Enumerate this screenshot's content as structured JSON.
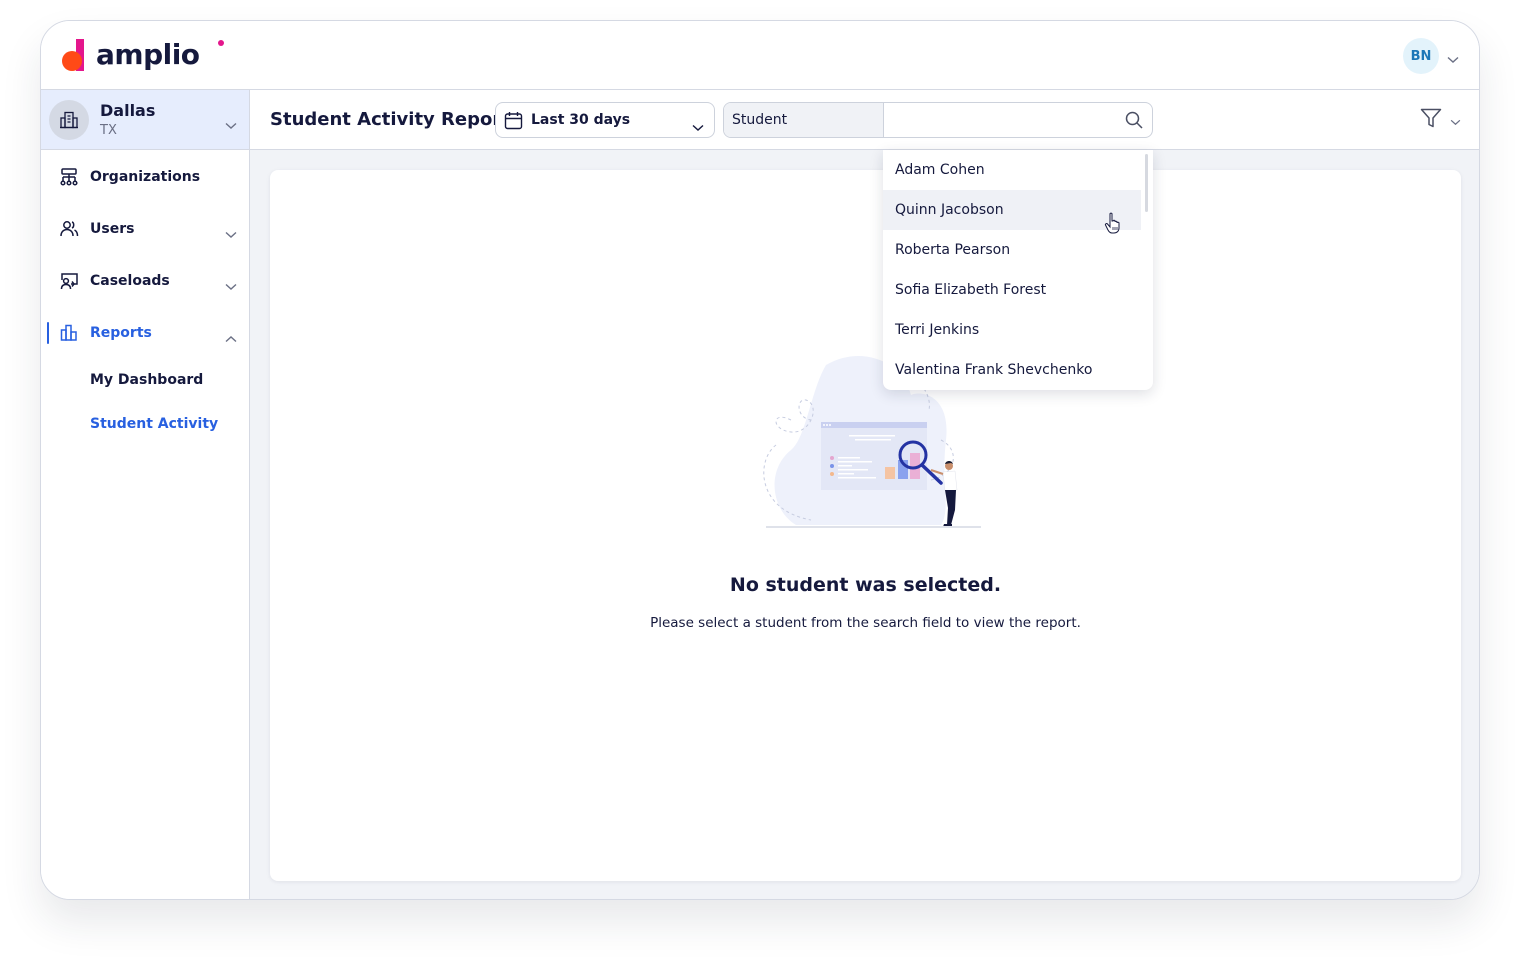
{
  "brand": {
    "name": "amplio",
    "colors": {
      "orange": "#ff4a17",
      "magenta": "#e4168c",
      "navy": "#15193d",
      "accent": "#2860e0"
    }
  },
  "user": {
    "initials": "BN"
  },
  "organization": {
    "name": "Dallas",
    "state": "TX"
  },
  "sidebar": {
    "items": [
      {
        "label": "Organizations",
        "icon": "org-chart-icon",
        "expandable": false
      },
      {
        "label": "Users",
        "icon": "users-icon",
        "expandable": true,
        "expanded": false
      },
      {
        "label": "Caseloads",
        "icon": "caseloads-icon",
        "expandable": true,
        "expanded": false
      },
      {
        "label": "Reports",
        "icon": "bar-chart-icon",
        "expandable": true,
        "expanded": true,
        "active": true
      }
    ],
    "reports_sub": [
      {
        "label": "My Dashboard",
        "active": false
      },
      {
        "label": "Student Activity",
        "active": true
      }
    ]
  },
  "toolbar": {
    "title": "Student Activity Report",
    "date_range": {
      "selected": "Last 30 days"
    },
    "student_search": {
      "prefix_label": "Student",
      "value": "",
      "placeholder": ""
    },
    "filter_label": "filter"
  },
  "dropdown": {
    "options": [
      "Adam Cohen",
      "Quinn Jacobson",
      "Roberta Pearson",
      "Sofia Elizabeth Forest",
      "Terri Jenkins",
      "Valentina Frank Shevchenko"
    ],
    "hovered_index": 1
  },
  "empty_state": {
    "title": "No student was selected.",
    "description": "Please select a student from the search field to view the report."
  }
}
